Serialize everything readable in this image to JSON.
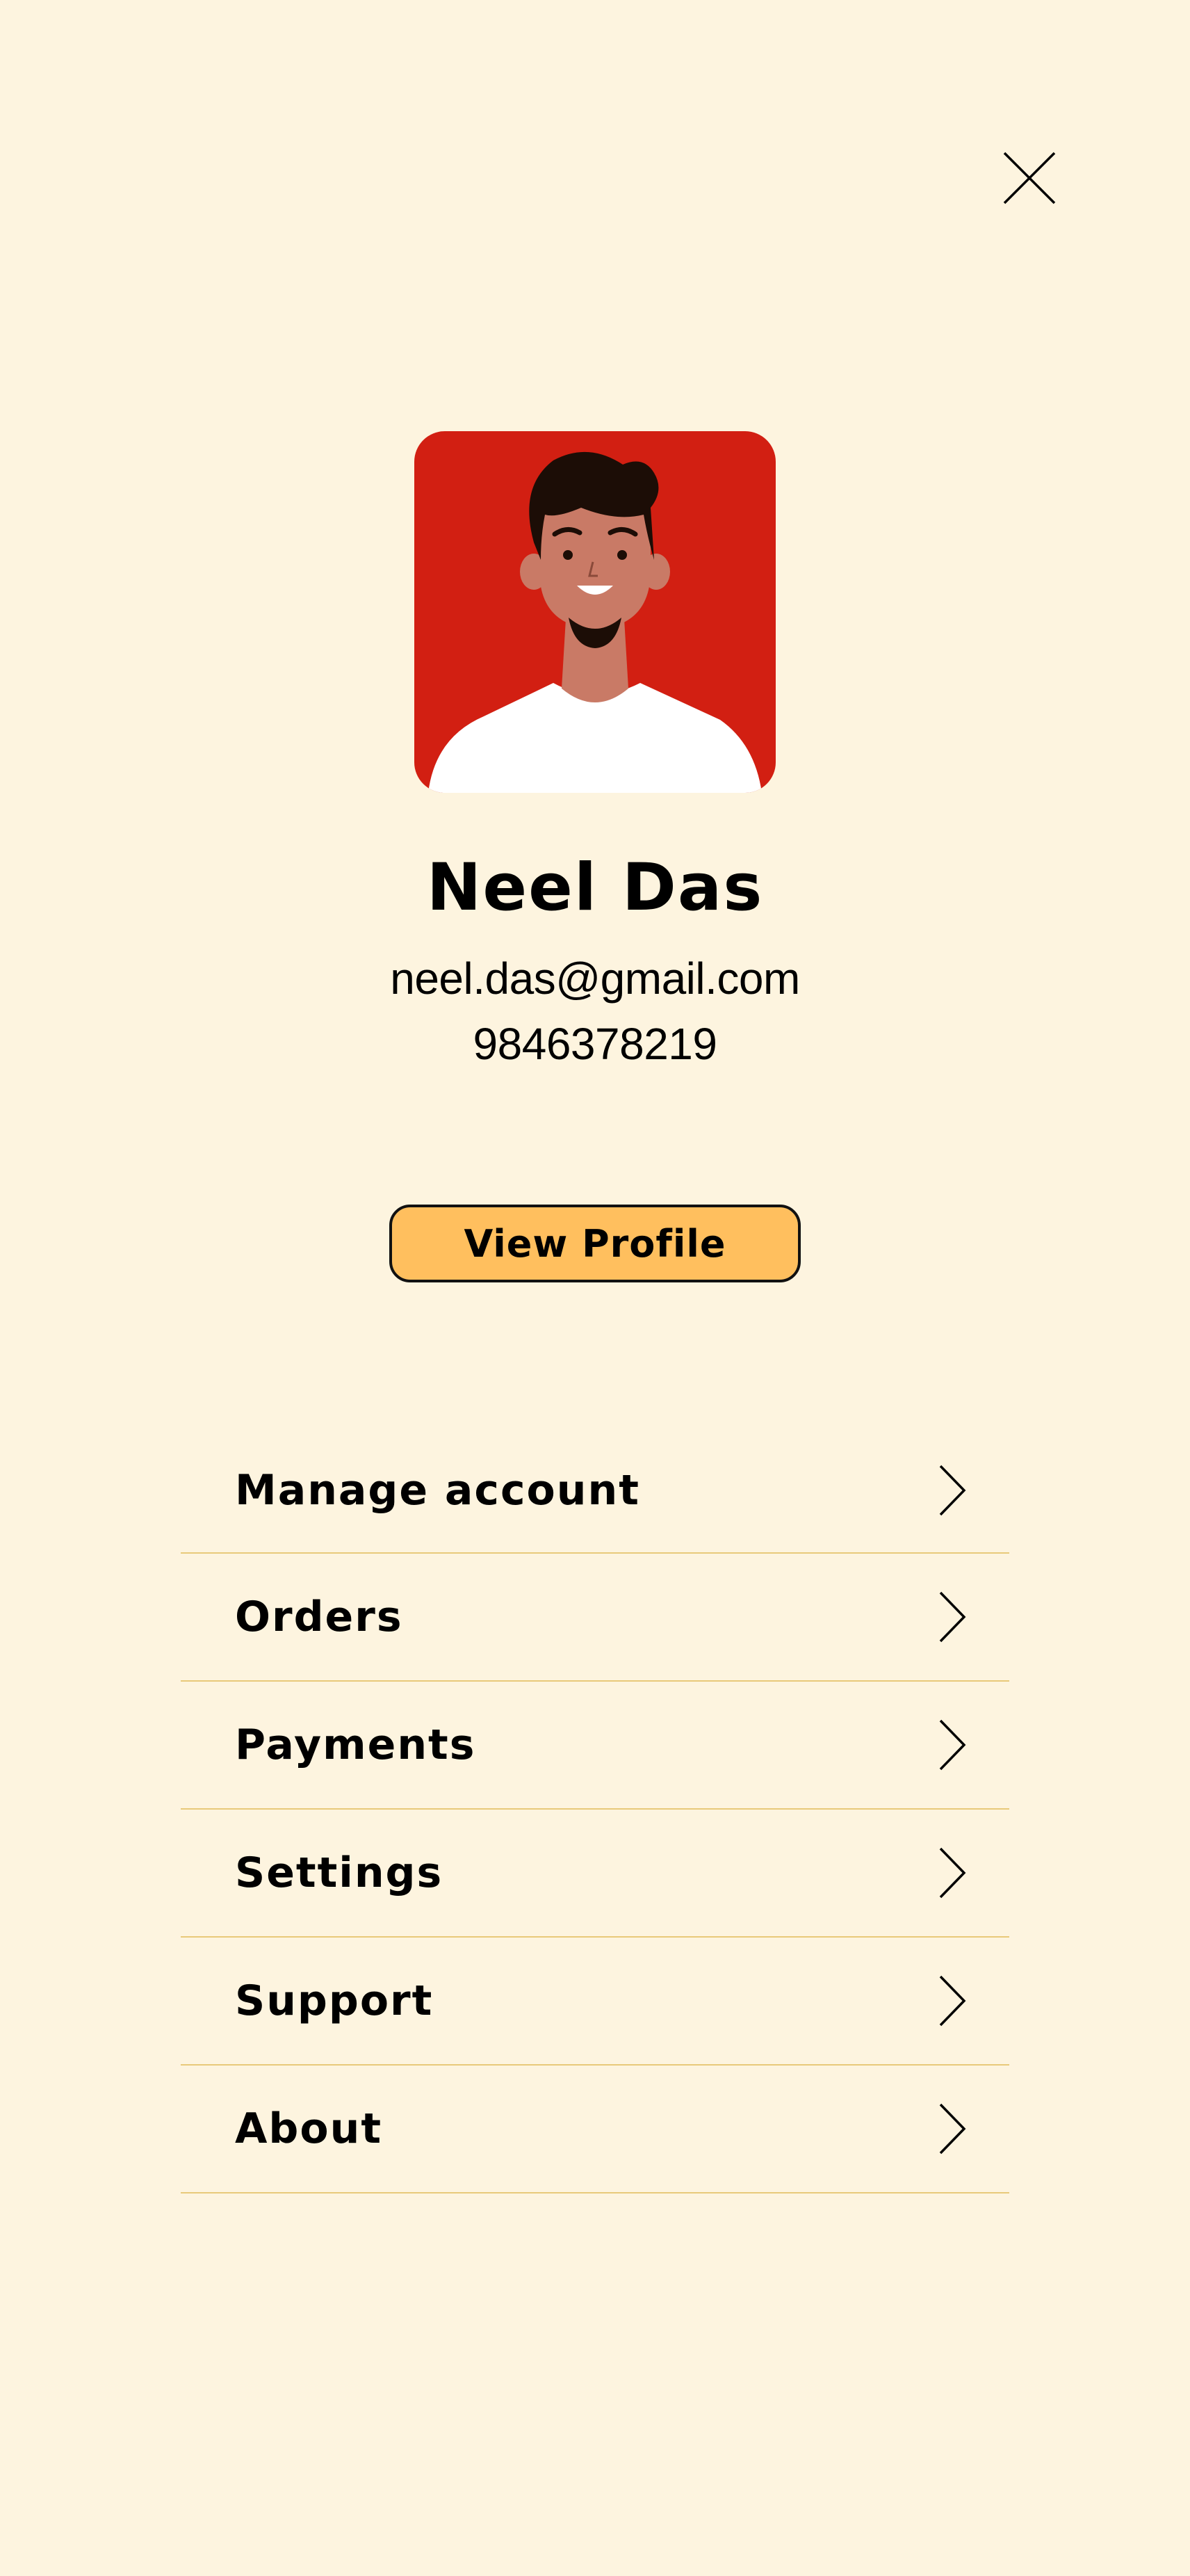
{
  "header": {
    "close_icon": "close-icon"
  },
  "profile": {
    "avatar_icon": "avatar-illustration",
    "name": "Neel Das",
    "email": "neel.das@gmail.com",
    "phone": "9846378219",
    "view_profile_label": "View Profile"
  },
  "menu": {
    "items": [
      {
        "label": "Manage account",
        "icon": "chevron-right-icon"
      },
      {
        "label": "Orders",
        "icon": "chevron-right-icon"
      },
      {
        "label": "Payments",
        "icon": "chevron-right-icon"
      },
      {
        "label": "Settings",
        "icon": "chevron-right-icon"
      },
      {
        "label": "Support",
        "icon": "chevron-right-icon"
      },
      {
        "label": "About",
        "icon": "chevron-right-icon"
      }
    ]
  },
  "colors": {
    "background": "#fdf4df",
    "avatar_background": "#d21f12",
    "button_fill": "#ffbf5e",
    "divider": "#e8c97a",
    "text": "#000000"
  }
}
